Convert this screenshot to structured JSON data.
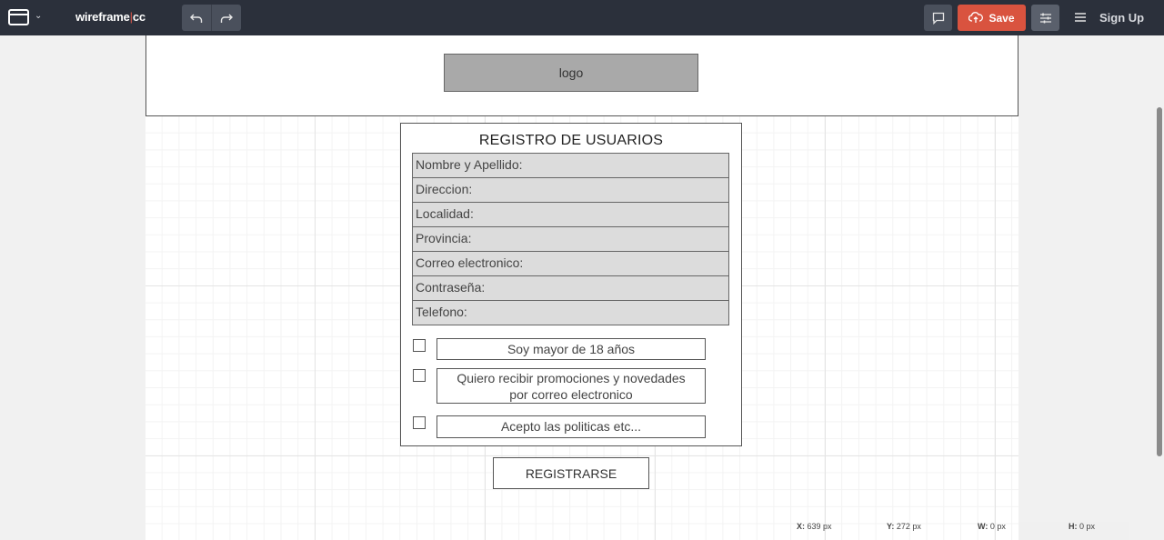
{
  "topbar": {
    "brand_left": "wireframe",
    "brand_sep": "|",
    "brand_right": "cc",
    "save_label": "Save",
    "signup_label": "Sign Up",
    "icons": {
      "window": "browser-window-icon",
      "dropdown": "chevron-down-icon",
      "undo": "undo-icon",
      "redo": "redo-icon",
      "comment": "comment-icon",
      "save": "cloud-upload-icon",
      "settings": "sliders-icon",
      "menu": "hamburger-menu-icon"
    },
    "colors": {
      "bar": "#2b303b",
      "save": "#d9533f"
    }
  },
  "wireframe": {
    "logo": "logo",
    "form": {
      "title": "REGISTRO DE USUARIOS",
      "fields": [
        "Nombre y Apellido:",
        "Direccion:",
        "Localidad:",
        "Provincia:",
        "Correo electronico:",
        "Contraseña:",
        "Telefono:"
      ],
      "checkboxes": [
        {
          "line1": "Soy mayor de 18 años",
          "line2": ""
        },
        {
          "line1": "Quiero recibir promociones y novedades",
          "line2": "por correo electronico"
        },
        {
          "line1": "Acepto las politicas etc...",
          "line2": ""
        }
      ]
    },
    "register_button": "REGISTRARSE"
  },
  "statusbar": {
    "x_label": "X:",
    "x_value": "639 px",
    "y_label": "Y:",
    "y_value": "272 px",
    "w_label": "W:",
    "w_value": "0 px",
    "h_label": "H:",
    "h_value": "0 px"
  }
}
